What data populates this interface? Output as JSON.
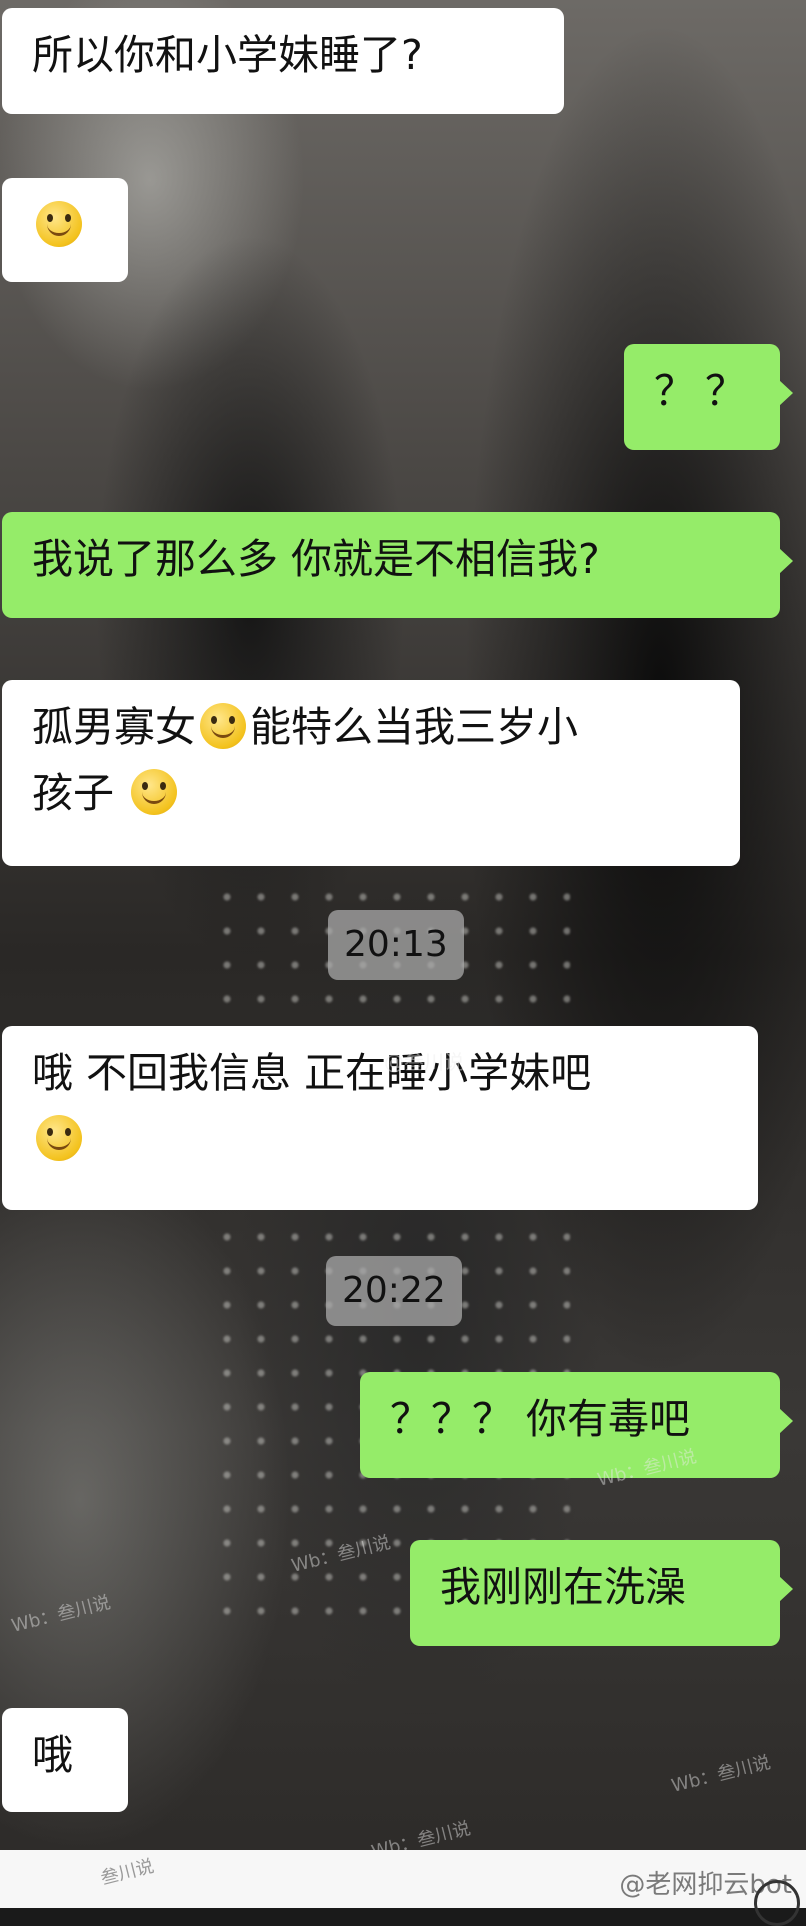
{
  "messages": [
    {
      "side": "in",
      "text": "所以你和小学妹睡了?"
    },
    {
      "side": "in",
      "emoji": "smile"
    },
    {
      "side": "out",
      "text": "？？"
    },
    {
      "side": "out",
      "text": "我说了那么多 你就是不相信我?"
    },
    {
      "side": "in",
      "line1_a": "孤男寡女",
      "line1_b": "能特么当我三岁小",
      "line2": "孩子"
    },
    {
      "side": "in",
      "line1": "哦 不回我信息 正在睡小学妹吧"
    },
    {
      "side": "out",
      "text": "？？？ 你有毒吧"
    },
    {
      "side": "out",
      "text": "我刚刚在洗澡"
    },
    {
      "side": "in",
      "text": "哦"
    }
  ],
  "timestamps": [
    "20:13",
    "20:22"
  ],
  "watermarks": [
    "@叁川说",
    "Wb：叁川说",
    "Wb：叁川说",
    "Wb：叁川说",
    "Wb：叁川说",
    "Wb：叁川说"
  ],
  "footer": {
    "credit": "@老网抑云bot",
    "watermark": "叁川说"
  }
}
